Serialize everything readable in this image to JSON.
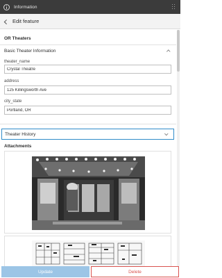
{
  "window": {
    "title": "Information"
  },
  "header": {
    "title": "Edit feature"
  },
  "layer": {
    "name": "OR Theaters"
  },
  "groups": [
    {
      "label": "Basic Theater Information",
      "expanded": true
    },
    {
      "label": "Theater History",
      "expanded": false
    }
  ],
  "fields": [
    {
      "label": "theater_name",
      "value": "Crystal Theatre"
    },
    {
      "label": "address",
      "value": "125 Killingsworth Ave"
    },
    {
      "label": "city_state",
      "value": "Portland, OR"
    }
  ],
  "attachments": {
    "label": "Attachments",
    "items": [
      {
        "kind": "photo",
        "icon": "theater-photo-image"
      },
      {
        "kind": "scan",
        "icon": "map-scan-image"
      }
    ]
  },
  "footer": {
    "update_label": "Update",
    "delete_label": "Delete"
  },
  "colors": {
    "accent": "#2e8bc9",
    "update_bg": "#9cc5e6",
    "delete": "#d9534f",
    "titlebar": "#3b3b3b"
  }
}
